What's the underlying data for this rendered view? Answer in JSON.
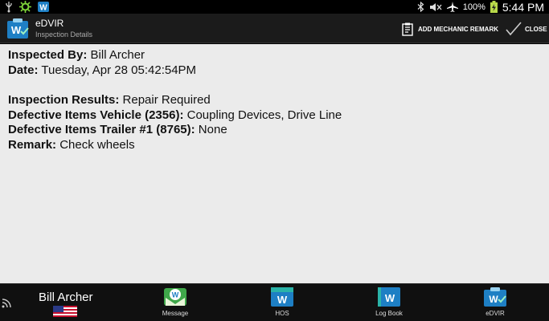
{
  "status_bar": {
    "battery": "100%",
    "time": "5:44 PM",
    "icons": [
      "usb-icon",
      "gear-alert-icon",
      "w-app-icon",
      "bluetooth-icon",
      "mute-icon",
      "airplane-icon",
      "battery-icon"
    ]
  },
  "action_bar": {
    "title": "eDVIR",
    "subtitle": "Inspection Details",
    "add_remark_label": "ADD MECHANIC REMARK",
    "close_label": "CLOSE"
  },
  "details": {
    "inspected_by_label": "Inspected By:",
    "inspected_by": "Bill Archer",
    "date_label": "Date:",
    "date": "Tuesday, Apr 28 05:42:54PM",
    "results_label": "Inspection Results:",
    "results": "Repair Required",
    "vehicle_label": "Defective Items Vehicle (2356):",
    "vehicle": "Coupling Devices, Drive Line",
    "trailer_label": "Defective Items Trailer #1 (8765):",
    "trailer": "None",
    "remark_label": "Remark:",
    "remark": "Check wheels"
  },
  "bottom_nav": {
    "user": "Bill Archer",
    "items": [
      {
        "label": "Message"
      },
      {
        "label": "HOS"
      },
      {
        "label": "Log Book"
      },
      {
        "label": "eDVIR"
      }
    ]
  },
  "colors": {
    "brand_blue": "#1e7fc4",
    "brand_teal": "#2ab3a8",
    "content_bg": "#ebebeb"
  }
}
